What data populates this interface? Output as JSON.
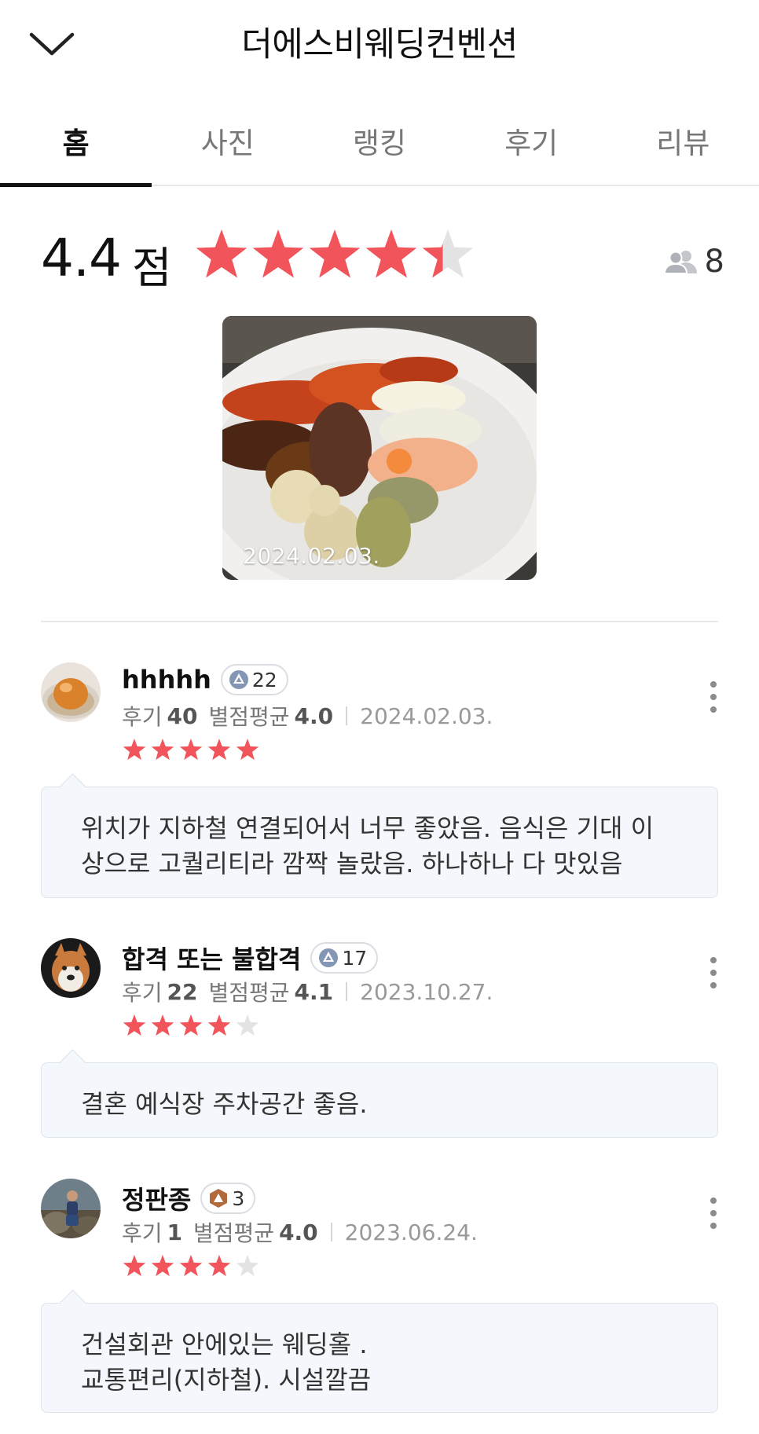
{
  "header": {
    "title": "더에스비웨딩컨벤션"
  },
  "tabs": [
    {
      "label": "홈",
      "active": true
    },
    {
      "label": "사진",
      "active": false
    },
    {
      "label": "랭킹",
      "active": false
    },
    {
      "label": "후기",
      "active": false
    },
    {
      "label": "리뷰",
      "active": false
    }
  ],
  "summary": {
    "score": "4.4",
    "score_unit": "점",
    "stars": 4.4,
    "reviewer_count": "8",
    "photo_date": "2024.02.03."
  },
  "colors": {
    "star": "#f2545b",
    "star_empty": "#e3e3e3",
    "bubble_bg": "#f4f7fb"
  },
  "meta_labels": {
    "reviews": "후기",
    "avg": "별점평균"
  },
  "reviews": [
    {
      "name": "hhhhh",
      "badge": "22",
      "badge_type": "blue",
      "review_count": "40",
      "avg_rating": "4.0",
      "date": "2024.02.03.",
      "stars": 5,
      "text_lines": [
        "위치가 지하철 연결되어서 너무 좋았음. 음식은 기대 이",
        "상으로 고퀄리티라 깜짝 놀랐음. 하나하나 다 맛있음"
      ]
    },
    {
      "name": "합격 또는 불합격",
      "badge": "17",
      "badge_type": "blue",
      "review_count": "22",
      "avg_rating": "4.1",
      "date": "2023.10.27.",
      "stars": 4,
      "text_lines": [
        "결혼 예식장 주차공간 좋음.",
        ""
      ]
    },
    {
      "name": "정판종",
      "badge": "3",
      "badge_type": "bronze",
      "review_count": "1",
      "avg_rating": "4.0",
      "date": "2023.06.24.",
      "stars": 4,
      "text_lines": [
        "건설회관 안에있는 웨딩홀 .",
        "교통편리(지하철). 시설깔끔"
      ]
    }
  ]
}
